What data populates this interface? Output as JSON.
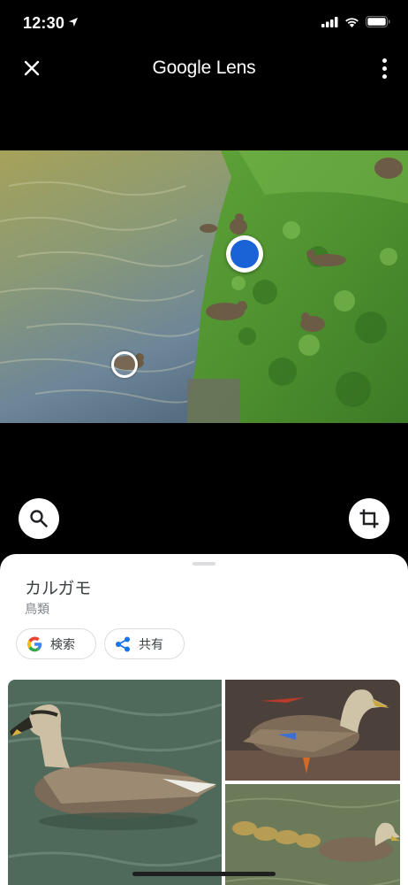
{
  "status_bar": {
    "time": "12:30"
  },
  "top_bar": {
    "title": "Google Lens"
  },
  "result": {
    "title": "カルガモ",
    "subtitle": "鳥類",
    "chips": [
      {
        "label": "検索",
        "icon": "google-g-icon"
      },
      {
        "label": "共有",
        "icon": "share-icon"
      }
    ]
  },
  "colors": {
    "accent": "#1a63d6",
    "sheet_bg": "#ffffff",
    "background": "#000000"
  }
}
